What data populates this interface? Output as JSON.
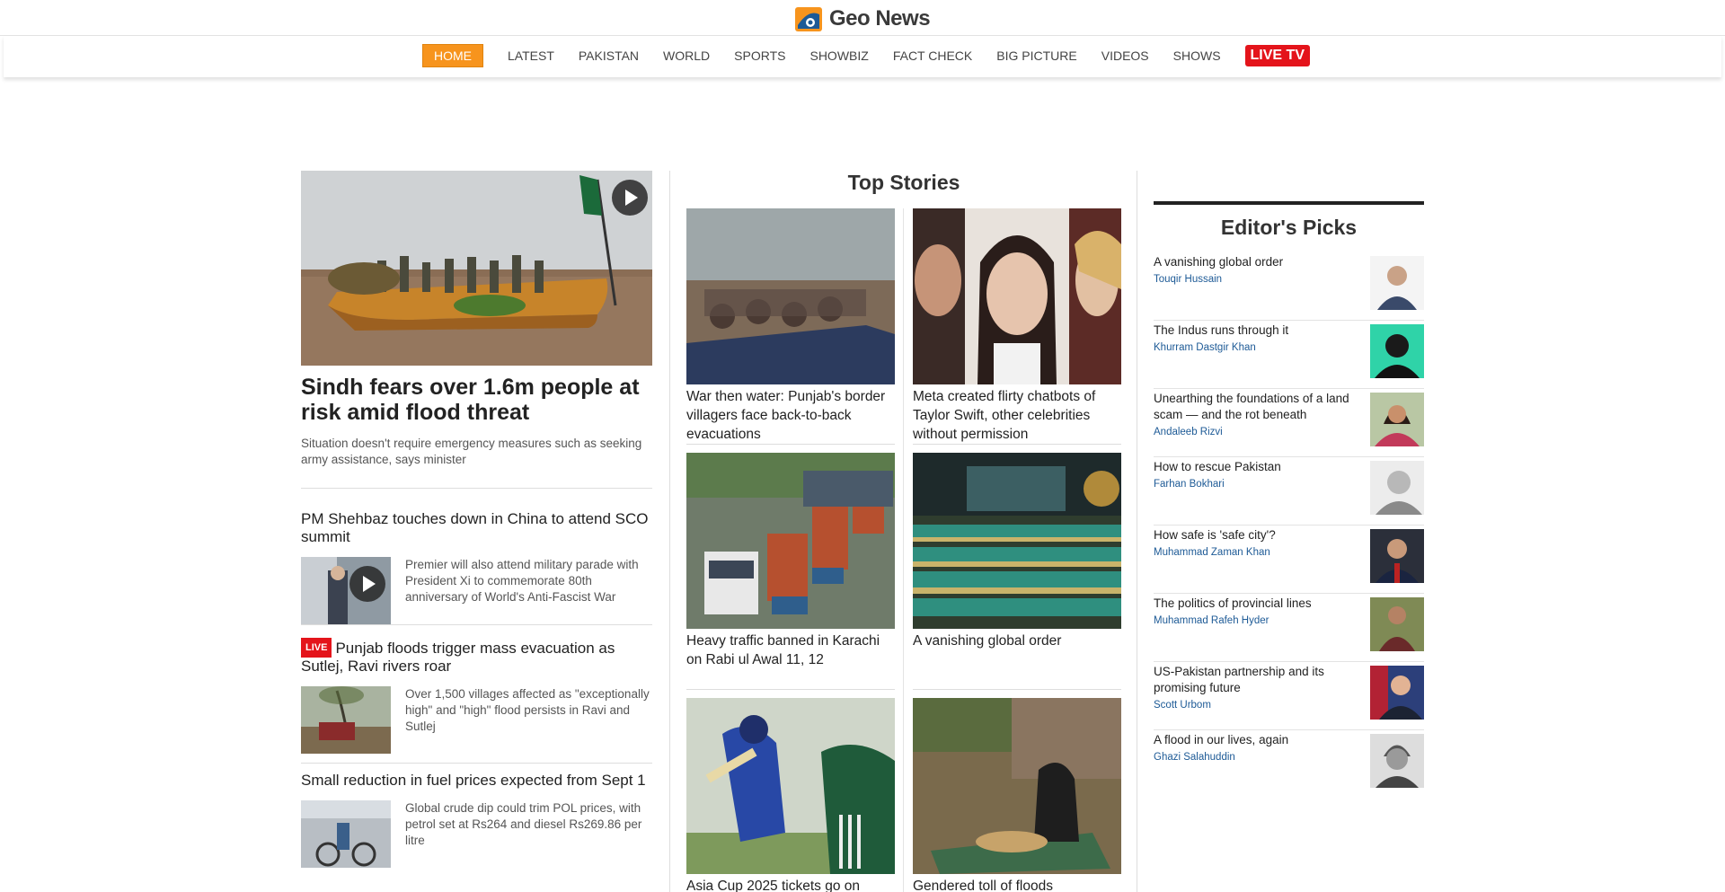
{
  "site": {
    "name": "Geo News",
    "accent": "#f7941d",
    "live_color": "#e4141b",
    "link_color": "#1d5a96"
  },
  "nav": {
    "items": [
      "HOME",
      "LATEST",
      "PAKISTAN",
      "WORLD",
      "SPORTS",
      "SHOWBIZ",
      "FACT CHECK",
      "BIG PICTURE",
      "VIDEOS",
      "SHOWS"
    ],
    "active": "HOME",
    "live": "LIVE TV"
  },
  "lead": {
    "title": "Sindh fears over 1.6m people at risk amid flood threat",
    "subtitle": "Situation doesn't require emergency measures such as seeking army assistance, says minister",
    "image": "flood-boat-photo",
    "has_video": true
  },
  "left_stories": [
    {
      "title": "PM Shehbaz touches down in China to attend SCO summit",
      "desc": "Premier will also attend military parade with President Xi to commemorate 80th anniversary of World's Anti-Fascist War",
      "has_video": true
    },
    {
      "badge": "LIVE",
      "title": "Punjab floods trigger mass evacuation as Sutlej, Ravi rivers roar",
      "desc": "Over 1,500 villages affected as \"exceptionally high\" and \"high\" flood persists in Ravi and Sutlej"
    },
    {
      "title": "Small reduction in fuel prices expected from Sept 1",
      "desc": "Global crude dip could trim POL prices, with petrol set at Rs264 and diesel Rs269.86 per litre"
    }
  ],
  "top_stories": {
    "heading": "Top Stories",
    "cards": [
      {
        "title": "War then water: Punjab's border villagers face back-to-back evacuations"
      },
      {
        "title": "Meta created flirty chatbots of Taylor Swift, other celebrities without permission"
      },
      {
        "title": "Heavy traffic banned in Karachi on Rabi ul Awal 11, 12"
      },
      {
        "title": "A vanishing global order"
      },
      {
        "title": "Asia Cup 2025 tickets go on"
      },
      {
        "title": "Gendered toll of floods"
      }
    ]
  },
  "editors_picks": {
    "heading": "Editor's Picks",
    "items": [
      {
        "title": "A vanishing global order",
        "author": "Touqir Hussain"
      },
      {
        "title": "The Indus runs through it",
        "author": "Khurram Dastgir Khan"
      },
      {
        "title": "Unearthing the foundations of a land scam — and the rot beneath",
        "author": "Andaleeb Rizvi"
      },
      {
        "title": "How to rescue Pakistan",
        "author": "Farhan Bokhari"
      },
      {
        "title": "How safe is 'safe city'?",
        "author": "Muhammad Zaman Khan"
      },
      {
        "title": "The politics of provincial lines",
        "author": "Muhammad Rafeh Hyder"
      },
      {
        "title": "US-Pakistan partnership and its promising future",
        "author": "Scott Urbom"
      },
      {
        "title": "A flood in our lives, again",
        "author": "Ghazi Salahuddin"
      }
    ]
  }
}
